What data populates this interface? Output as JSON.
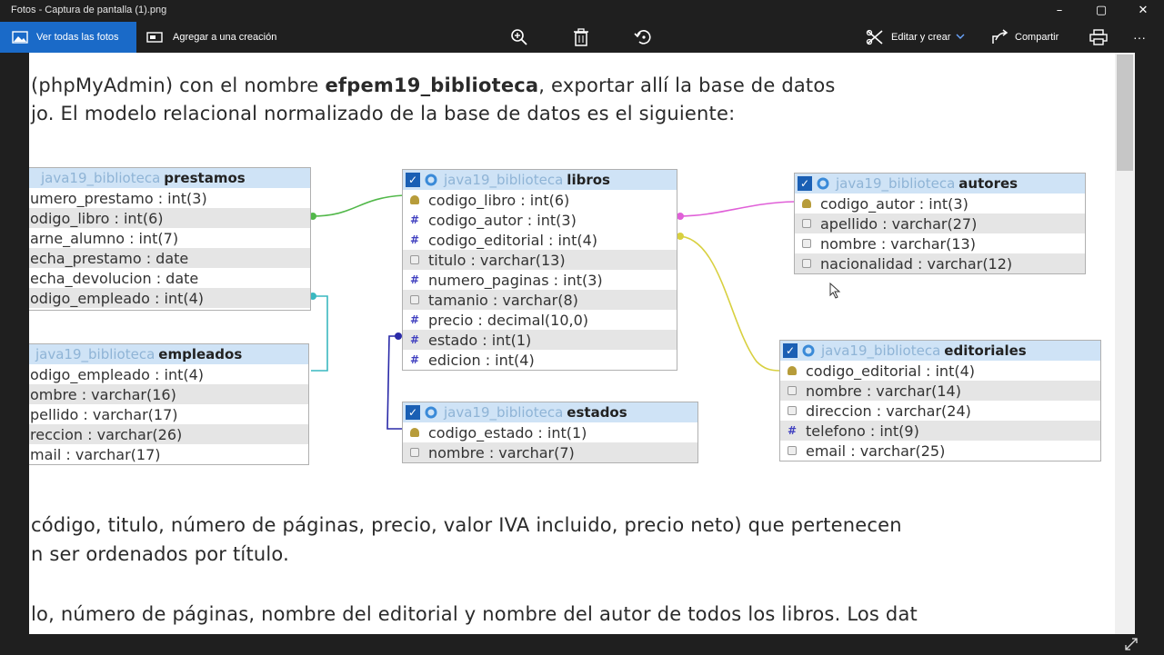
{
  "window": {
    "title": "Fotos - Captura de pantalla (1).png",
    "controls": [
      "–",
      "▢",
      "✕"
    ]
  },
  "toolbar": {
    "view_all": "Ver todas las fotos",
    "add_to_creation": "Agregar a una creación",
    "edit_create": "Editar y crear",
    "share": "Compartir",
    "more": "···"
  },
  "document": {
    "line1_pre": "(phpMyAdmin) con el nombre ",
    "line1_bold": "efpem19_biblioteca",
    "line1_post": ", exportar allí la base de datos",
    "line2": "jo. El modelo relacional normalizado de la base de datos es el siguiente:",
    "line3": "código, titulo, número de páginas, precio, valor IVA incluido, precio neto) que pertenecen",
    "line4": "n ser ordenados por título.",
    "line5": "lo, número de páginas, nombre del editorial y nombre del autor de todos los libros.  Los dat"
  },
  "diagram": {
    "db_prefix": "java19_biblioteca",
    "tables": {
      "prestamos": {
        "name": "prestamos",
        "fields": [
          "umero_prestamo : int(3)",
          "odigo_libro : int(6)",
          "arne_alumno : int(7)",
          "echa_prestamo : date",
          "echa_devolucion : date",
          "odigo_empleado : int(4)"
        ]
      },
      "empleados": {
        "name": "empleados",
        "fields": [
          "odigo_empleado : int(4)",
          "ombre : varchar(16)",
          "pellido : varchar(17)",
          "reccion : varchar(26)",
          "mail : varchar(17)"
        ]
      },
      "libros": {
        "name": "libros",
        "fields": [
          "codigo_libro : int(6)",
          "codigo_autor : int(3)",
          "codigo_editorial : int(4)",
          "titulo : varchar(13)",
          "numero_paginas : int(3)",
          "tamanio : varchar(8)",
          "precio : decimal(10,0)",
          "estado : int(1)",
          "edicion : int(4)"
        ],
        "icons": [
          "key",
          "num",
          "num",
          "txt",
          "num",
          "txt",
          "num",
          "num",
          "num"
        ]
      },
      "estados": {
        "name": "estados",
        "fields": [
          "codigo_estado : int(1)",
          "nombre : varchar(7)"
        ],
        "icons": [
          "key",
          "txt"
        ]
      },
      "autores": {
        "name": "autores",
        "fields": [
          "codigo_autor : int(3)",
          "apellido : varchar(27)",
          "nombre : varchar(13)",
          "nacionalidad : varchar(12)"
        ],
        "icons": [
          "key",
          "txt",
          "txt",
          "txt"
        ]
      },
      "editoriales": {
        "name": "editoriales",
        "fields": [
          "codigo_editorial : int(4)",
          "nombre : varchar(14)",
          "direccion : varchar(24)",
          "telefono : int(9)",
          "email : varchar(25)"
        ],
        "icons": [
          "key",
          "txt",
          "txt",
          "num",
          "txt"
        ]
      }
    },
    "relation_colors": [
      "#52b84a",
      "#3ab8c0",
      "#e060d8",
      "#d8d040",
      "#2a2aa8"
    ]
  }
}
